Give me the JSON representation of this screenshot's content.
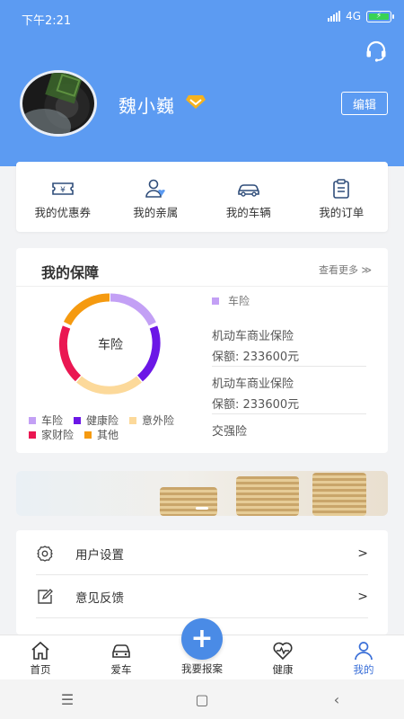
{
  "status_bar": {
    "time": "下午2:21",
    "network": "4G",
    "battery": "⚡"
  },
  "profile": {
    "name": "魏小巍",
    "edit_label": "编辑"
  },
  "quick_actions": [
    {
      "label": "我的优惠券",
      "icon": "coupon-icon"
    },
    {
      "label": "我的亲属",
      "icon": "family-icon"
    },
    {
      "label": "我的车辆",
      "icon": "car-icon"
    },
    {
      "label": "我的订单",
      "icon": "order-icon"
    }
  ],
  "protection": {
    "title": "我的保障",
    "more_label": "查看更多 ≫",
    "donut_label": "车险",
    "legend": [
      {
        "label": "车险",
        "color": "#c3a0f5"
      },
      {
        "label": "健康险",
        "color": "#6b17e6"
      },
      {
        "label": "意外险",
        "color": "#fcd99a"
      },
      {
        "label": "家财险",
        "color": "#ea1752"
      },
      {
        "label": "其他",
        "color": "#f59a10"
      }
    ],
    "category": "车险",
    "policies": [
      {
        "name": "机动车商业保险",
        "amount": "保额: 233600元"
      },
      {
        "name": "机动车商业保险",
        "amount": "保额: 233600元"
      },
      {
        "name": "交强险"
      }
    ]
  },
  "settings": [
    {
      "label": "用户设置",
      "icon": "gear-icon",
      "chevron": ">"
    },
    {
      "label": "意见反馈",
      "icon": "feedback-icon",
      "chevron": ">"
    }
  ],
  "tabbar": {
    "home": "首页",
    "car": "爱车",
    "report": "我要报案",
    "health": "健康",
    "mine": "我的"
  },
  "nav": {
    "menu": "☰",
    "home": "▢",
    "back": "‹"
  }
}
